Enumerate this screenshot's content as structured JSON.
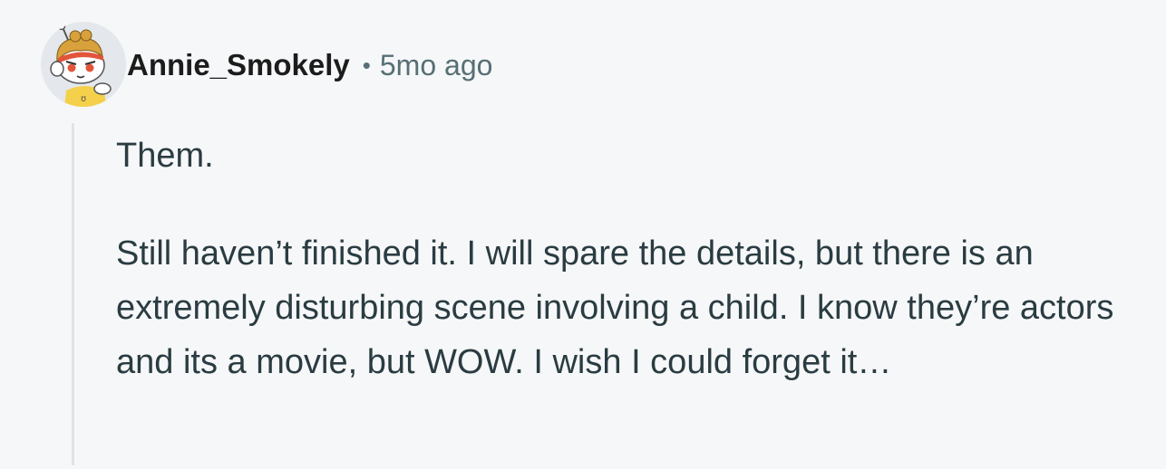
{
  "comment": {
    "author": "Annie_Smokely",
    "separator": "•",
    "timestamp": "5mo ago",
    "paragraphs": [
      "Them.",
      "Still haven’t finished it. I will spare the details, but there is an extremely disturbing scene involving a child. I know they’re actors and its a movie, but WOW. I wish I could forget it…"
    ]
  },
  "colors": {
    "background": "#f6f7f8",
    "author": "#1c1c1c",
    "meta": "#576f76",
    "body": "#2a3c42",
    "thread_line": "#dfe3e6"
  },
  "icons": {
    "avatar": "snoo-avatar-icon"
  }
}
